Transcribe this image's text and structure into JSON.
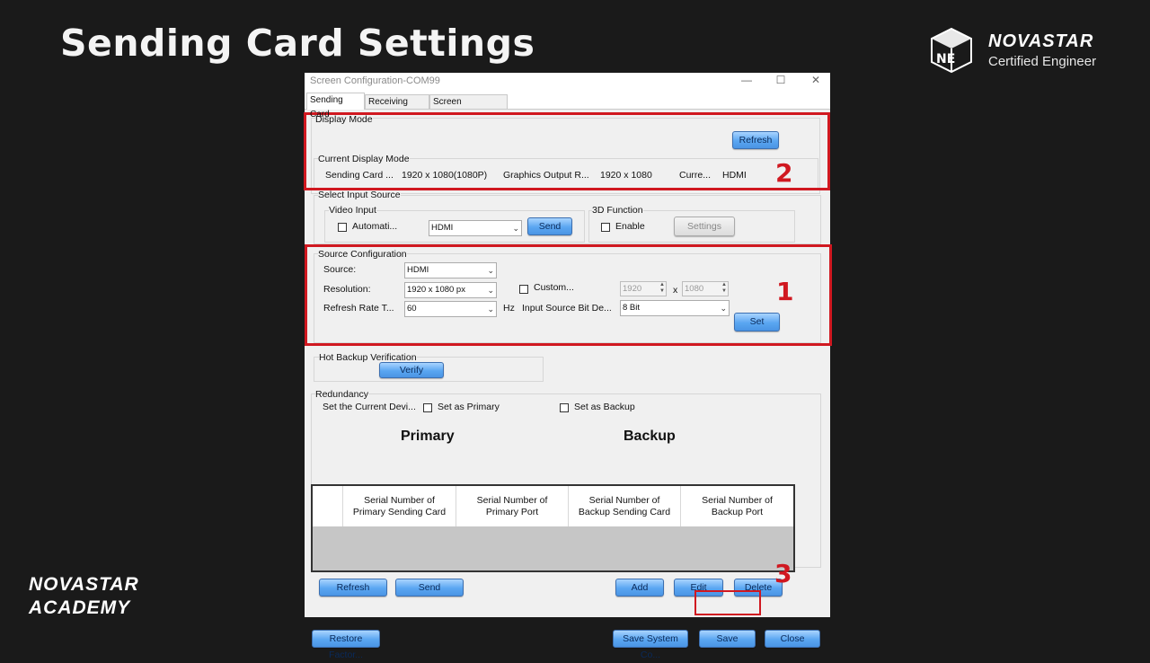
{
  "slide": {
    "title": "Sending Card Settings",
    "brand_name": "NOVASTAR",
    "brand_sub": "Certified Engineer",
    "academy_line1": "NOVASTAR",
    "academy_line2": "ACADEMY",
    "ne_logo_text": "NE"
  },
  "window": {
    "title": "Screen Configuration-COM99",
    "minimize": "—",
    "maximize": "☐",
    "close": "✕"
  },
  "tabs": [
    "Sending Card",
    "Receiving Card",
    "Screen Connection"
  ],
  "display_mode": {
    "label": "Display Mode",
    "refresh": "Refresh",
    "current_label": "Current Display Mode",
    "sending_card": "Sending Card ...",
    "sending_card_res": "1920 x 1080(1080P)",
    "graphics_output": "Graphics Output R...",
    "graphics_res": "1920 x 1080",
    "curr": "Curre...",
    "curr_value": "HDMI"
  },
  "input_source": {
    "label": "Select Input Source",
    "video_input": "Video Input",
    "automatic": "Automati...",
    "combo_value": "HDMI",
    "send": "Send",
    "function_3d": "3D Function",
    "enable": "Enable",
    "settings": "Settings"
  },
  "source_config": {
    "label": "Source Configuration",
    "source_label": "Source:",
    "source_value": "HDMI",
    "resolution_label": "Resolution:",
    "resolution_value": "1920 x 1080 px",
    "custom": "Custom...",
    "width": "1920",
    "x": "x",
    "height": "1080",
    "refresh_label": "Refresh Rate T...",
    "refresh_value": "60",
    "hz": "Hz",
    "bit_depth_label": "Input Source Bit De...",
    "bit_depth_value": "8 Bit",
    "set": "Set"
  },
  "hot_backup": {
    "label": "Hot Backup Verification",
    "verify": "Verify"
  },
  "redundancy": {
    "label": "Redundancy",
    "set_current": "Set the Current Devi...",
    "set_primary": "Set as Primary",
    "set_backup": "Set as Backup",
    "primary_heading": "Primary",
    "backup_heading": "Backup",
    "columns": [
      "Serial Number of Primary Sending Card",
      "Serial Number of Primary Port",
      "Serial Number of Backup Sending Card",
      "Serial Number of Backup Port"
    ],
    "refresh": "Refresh",
    "send": "Send",
    "add": "Add",
    "edit": "Edit",
    "delete": "Delete"
  },
  "footer": {
    "restore": "Restore Factor...",
    "save_system": "Save System Co...",
    "save": "Save",
    "close": "Close"
  },
  "annotations": {
    "one": "1",
    "two": "2",
    "three": "3"
  },
  "colors": {
    "highlight": "#d01820",
    "button": "#5aa6f1",
    "background": "#1a1a1a"
  }
}
